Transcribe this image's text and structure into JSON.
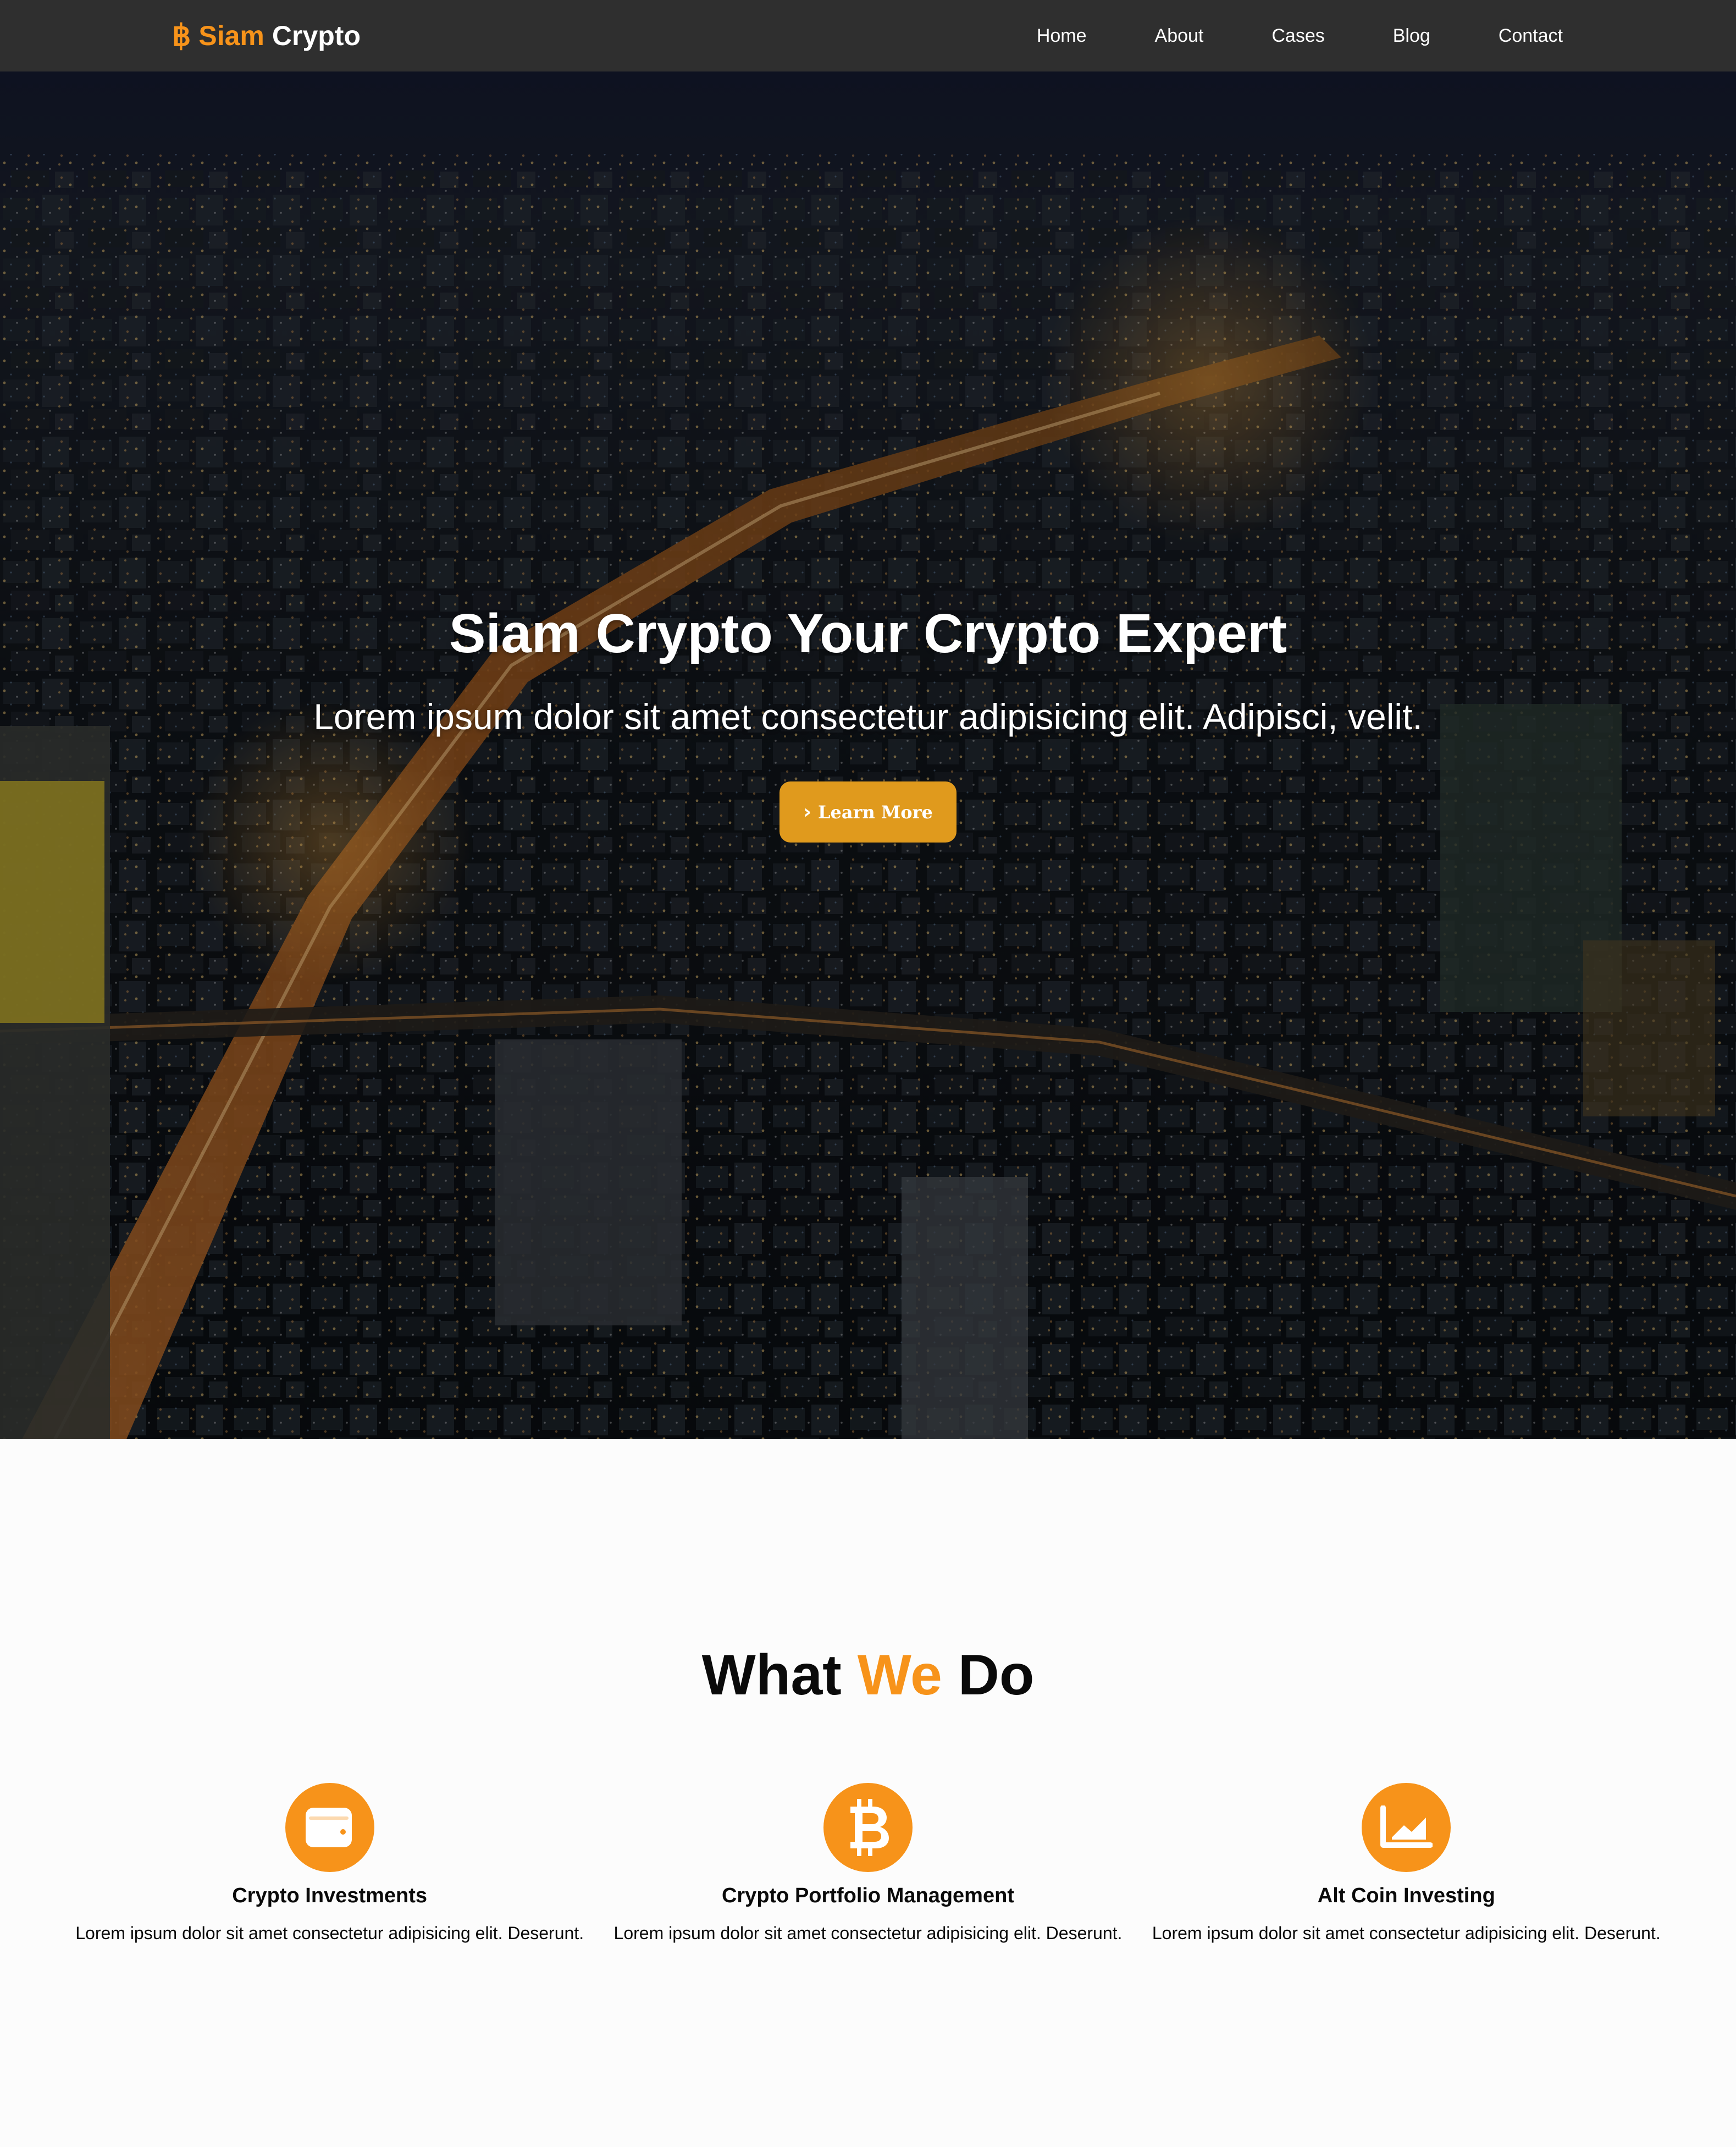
{
  "brand": {
    "symbol": "฿",
    "name_accent": "Siam",
    "name_rest": "Crypto"
  },
  "nav": {
    "items": [
      {
        "label": "Home"
      },
      {
        "label": "About"
      },
      {
        "label": "Cases"
      },
      {
        "label": "Blog"
      },
      {
        "label": "Contact"
      }
    ]
  },
  "hero": {
    "title": "Siam Crypto Your Crypto Expert",
    "subtitle": "Lorem ipsum dolor sit amet consectetur adipisicing elit. Adipisci, velit.",
    "button_label": "Learn More",
    "button_icon": "chevron-right-icon"
  },
  "services": {
    "title_part1": "What",
    "title_accent": "We",
    "title_part2": "Do",
    "cards": [
      {
        "icon": "wallet-icon",
        "title": "Crypto Investments",
        "text": "Lorem ipsum dolor sit amet consectetur adipisicing elit. Deserunt."
      },
      {
        "icon": "bitcoin-icon",
        "title": "Crypto Portfolio Management",
        "text": "Lorem ipsum dolor sit amet consectetur adipisicing elit. Deserunt."
      },
      {
        "icon": "chart-line-icon",
        "title": "Alt Coin Investing",
        "text": "Lorem ipsum dolor sit amet consectetur adipisicing elit. Deserunt."
      }
    ]
  },
  "colors": {
    "accent": "#f7931a",
    "button": "#e09a1d",
    "navbar": "#2f2f2f"
  }
}
